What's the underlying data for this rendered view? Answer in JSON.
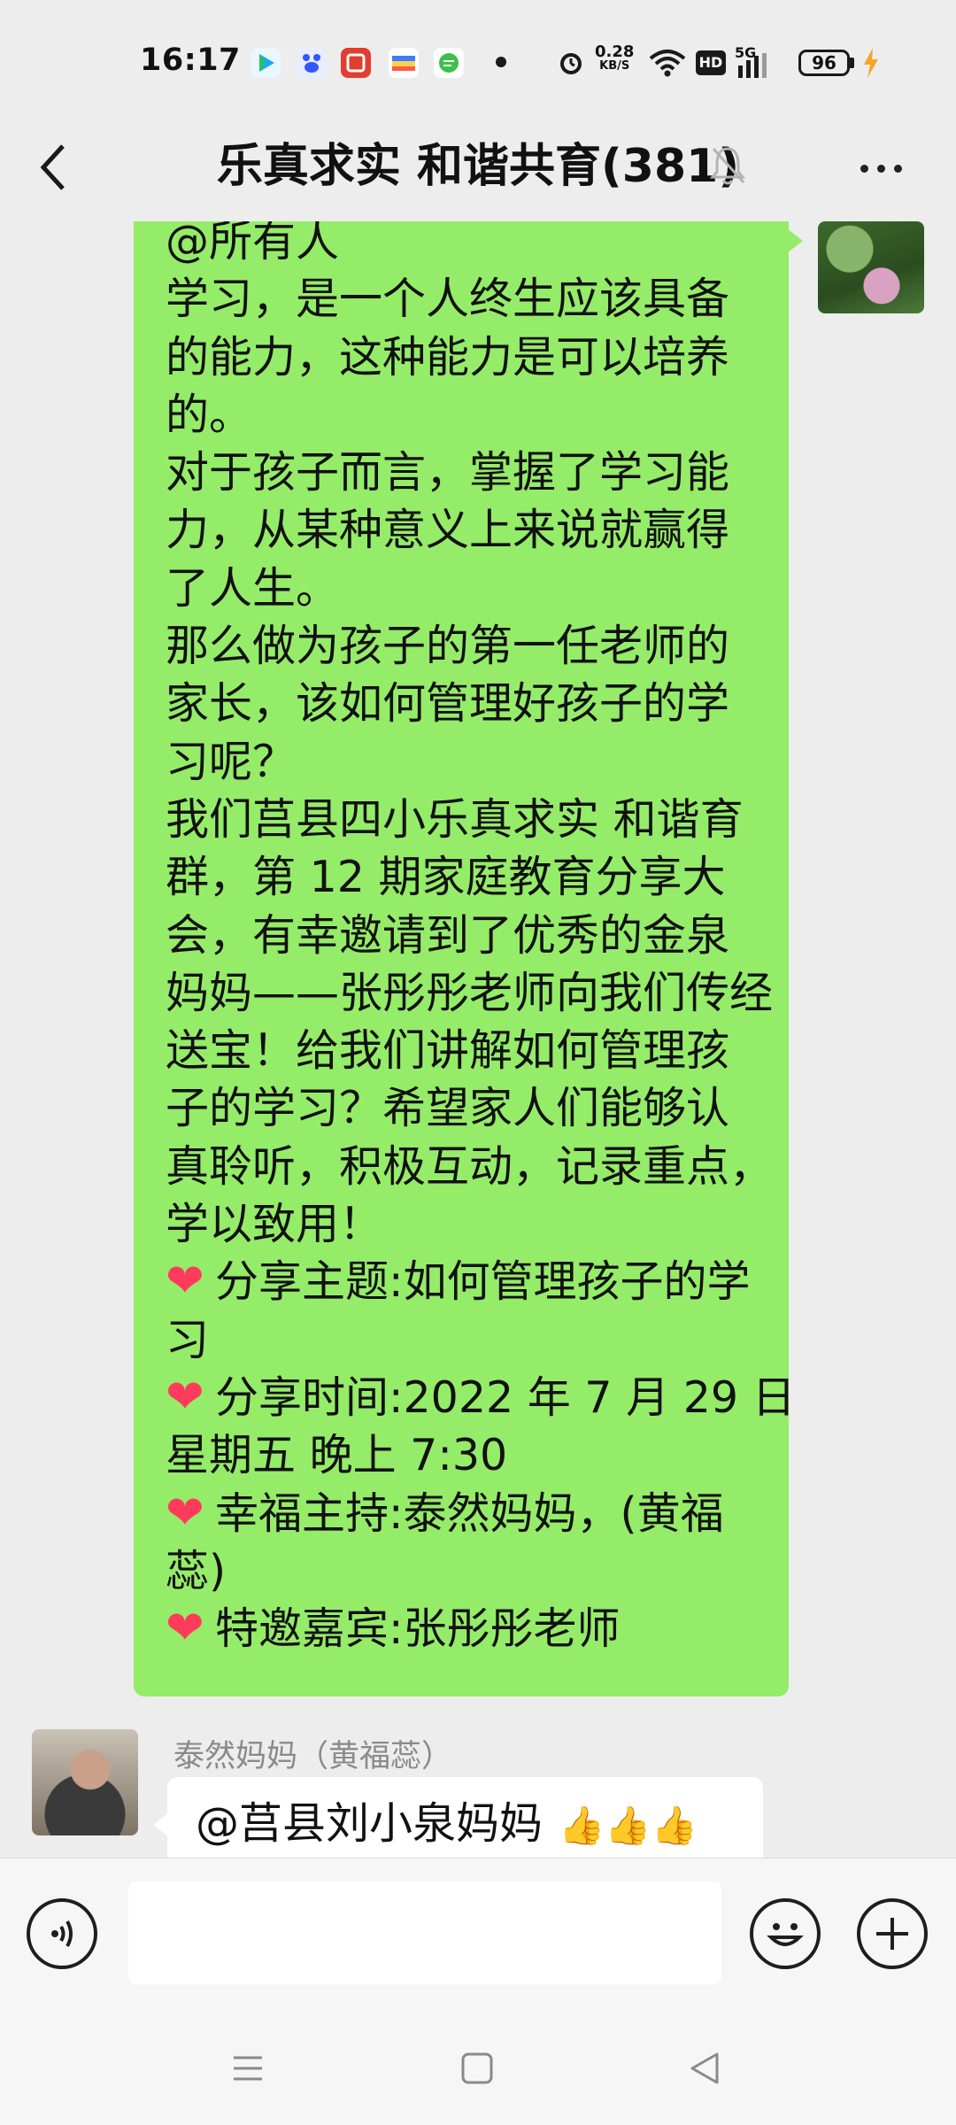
{
  "status_bar": {
    "time": "16:17",
    "net_speed_value": "0.28",
    "net_speed_unit": "KB/S",
    "battery": "96",
    "hd_label": "HD",
    "signal_label": "5G",
    "icons": [
      "video-app-icon",
      "baidu-icon",
      "ting-app-icon",
      "wallet-app-icon",
      "wechat-green-icon",
      "alarm-icon",
      "wifi-icon",
      "hd-icon",
      "signal-icon",
      "battery-icon",
      "charging-icon"
    ],
    "app_icon_colors": [
      "#e9f7ff",
      "#e8edff",
      "#e33d2f",
      "#f7d54a",
      "#3fc04b"
    ]
  },
  "header": {
    "title": "乐真求实 和谐共育(381)"
  },
  "messages": {
    "outgoing": {
      "lines": [
        "@所有人",
        "学习，是一个人终生应该具备",
        "的能力，这种能力是可以培养",
        "的。",
        "对于孩子而言，掌握了学习能",
        "力，从某种意义上来说就赢得",
        "了人生。",
        "那么做为孩子的第一任老师的",
        "家长，该如何管理好孩子的学",
        "习呢？",
        "我们莒县四小乐真求实 和谐育",
        "群，第 12 期家庭教育分享大",
        "会，有幸邀请到了优秀的金泉",
        "妈妈——张彤彤老师向我们传经",
        "送宝！给我们讲解如何管理孩",
        "子的学习？希望家人们能够认",
        "真聆听，积极互动，记录重点，",
        "学以致用！"
      ],
      "heart_items": [
        {
          "first": "分享主题:如何管理孩子的学",
          "second": "习"
        },
        {
          "first": "分享时间:2022 年 7 月 29 日",
          "second": "星期五 晚上 7:30"
        },
        {
          "first": "幸福主持:泰然妈妈，(黄福",
          "second": "蕊)"
        },
        {
          "first": "特邀嘉宾:张彤彤老师",
          "second": ""
        }
      ],
      "bubble_color": "#95ec69"
    },
    "incoming": {
      "sender": "泰然妈妈（黄福蕊）",
      "text": "@莒县刘小泉妈妈",
      "thumbs": "👍👍👍"
    }
  },
  "input_bar": {
    "placeholder": ""
  },
  "colors": {
    "background": "#ededed",
    "heart": "#ff3b5c"
  }
}
